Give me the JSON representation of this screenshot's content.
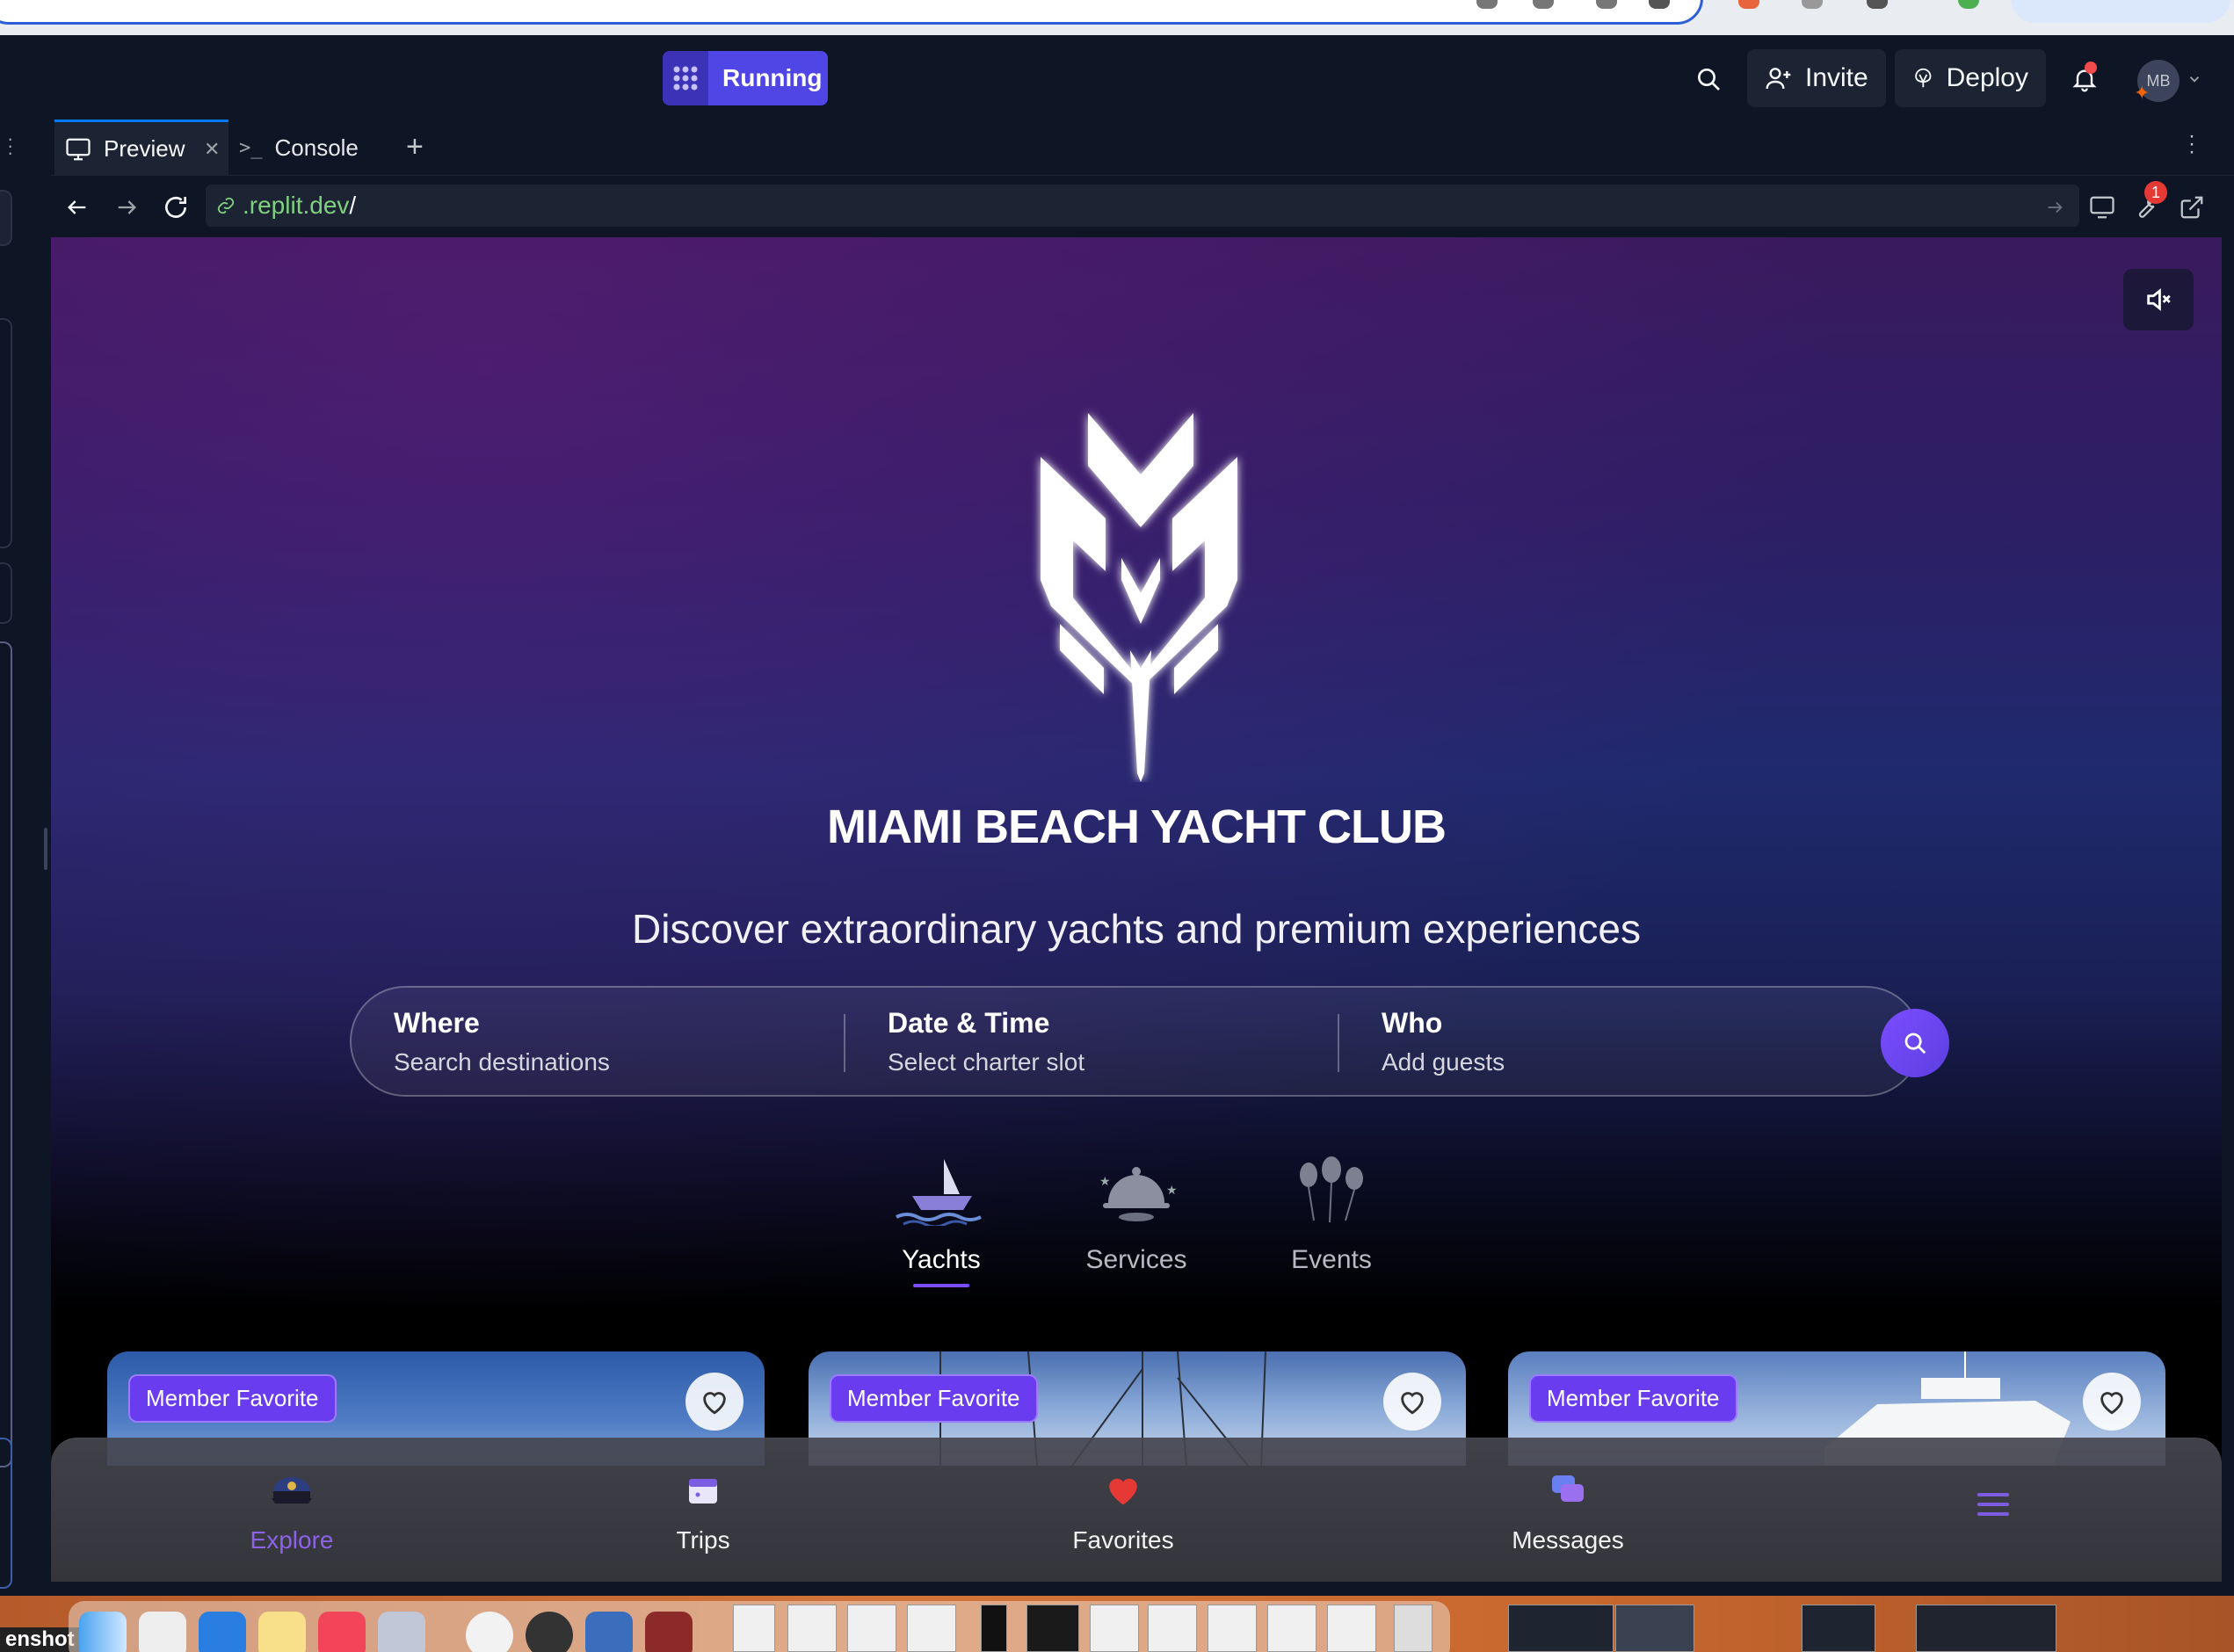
{
  "header": {
    "run_label": "Running",
    "invite_label": "Invite",
    "deploy_label": "Deploy",
    "avatar_initials": "MB"
  },
  "tabs": {
    "preview_label": "Preview",
    "console_label": "Console"
  },
  "urlbar": {
    "url_host": ".replit.dev",
    "url_path": "/",
    "devtools_badge": "1"
  },
  "site": {
    "title": "MIAMI BEACH YACHT CLUB",
    "tagline": "Discover extraordinary yachts and premium experiences",
    "search": {
      "where_label": "Where",
      "where_placeholder": "Search destinations",
      "date_label": "Date & Time",
      "date_placeholder": "Select charter slot",
      "who_label": "Who",
      "who_placeholder": "Add guests"
    },
    "categories": [
      {
        "label": "Yachts",
        "active": true
      },
      {
        "label": "Services",
        "active": false
      },
      {
        "label": "Events",
        "active": false
      }
    ],
    "cards": [
      {
        "badge": "Member Favorite"
      },
      {
        "badge": "Member Favorite"
      },
      {
        "badge": "Member Favorite"
      }
    ],
    "bottom_nav": [
      {
        "label": "Explore",
        "active": true
      },
      {
        "label": "Trips",
        "active": false
      },
      {
        "label": "Favorites",
        "active": false
      },
      {
        "label": "Messages",
        "active": false
      }
    ]
  },
  "desktop": {
    "screenshot_label": "enshot"
  },
  "colors": {
    "accent": "#4f46e5",
    "brand_purple": "#7c4dff",
    "active_nav": "#8c63e8"
  }
}
